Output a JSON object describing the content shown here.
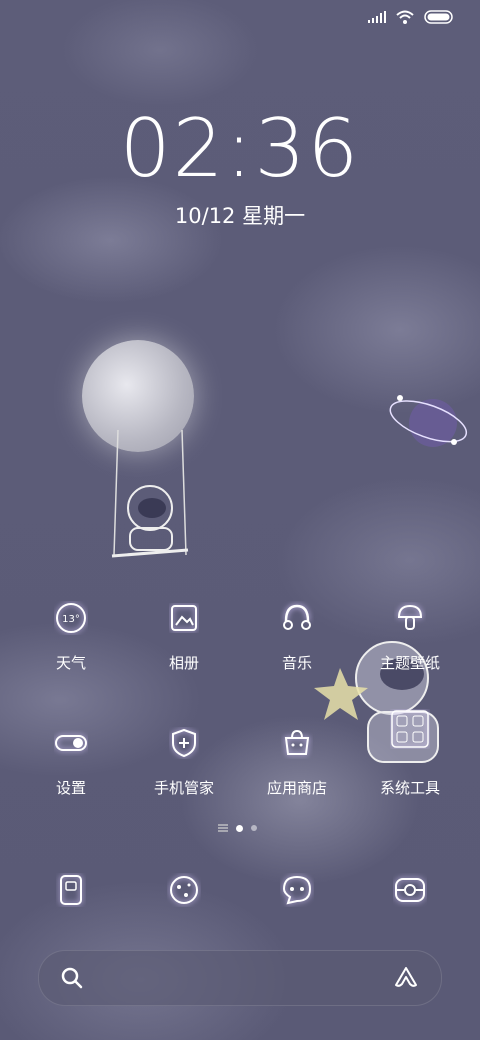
{
  "status": {
    "signal_icon": "signal-icon",
    "wifi_icon": "wifi-icon",
    "battery_icon": "battery-icon"
  },
  "lock": {
    "time": "02:36",
    "date": "10/12 星期一"
  },
  "apps": [
    {
      "label": "天气",
      "icon": "weather-icon",
      "temp": "13°"
    },
    {
      "label": "相册",
      "icon": "gallery-icon"
    },
    {
      "label": "音乐",
      "icon": "music-icon"
    },
    {
      "label": "主题壁纸",
      "icon": "themes-icon"
    },
    {
      "label": "设置",
      "icon": "settings-icon"
    },
    {
      "label": "手机管家",
      "icon": "security-icon"
    },
    {
      "label": "应用商店",
      "icon": "app-store-icon"
    },
    {
      "label": "系统工具",
      "icon": "tools-folder-icon"
    }
  ],
  "dock": [
    {
      "icon": "phone-icon"
    },
    {
      "icon": "browser-icon"
    },
    {
      "icon": "messages-icon"
    },
    {
      "icon": "camera-icon"
    }
  ],
  "search": {
    "icon": "search-icon",
    "assistant_icon": "assistant-icon"
  },
  "colors": {
    "icon_glow": "#d8c8ff",
    "background": "#5c5c78"
  }
}
